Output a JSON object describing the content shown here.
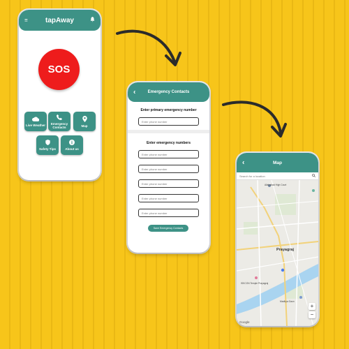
{
  "home": {
    "title": "tapAway",
    "menu_icon": "≡",
    "bell_icon": "🔔",
    "sos_label": "SOS",
    "tiles": [
      {
        "label": "Live Weather",
        "icon": "cloud-icon"
      },
      {
        "label": "Emergency Contacts",
        "icon": "phone-icon"
      },
      {
        "label": "Map",
        "icon": "map-pin-icon"
      },
      {
        "label": "Safety Tips",
        "icon": "shield-icon"
      },
      {
        "label": "About us",
        "icon": "info-icon"
      }
    ]
  },
  "contacts": {
    "title": "Emergency Contacts",
    "back_icon": "‹",
    "primary_heading": "Enter primary emergency number",
    "primary_placeholder": "Enter phone number",
    "secondary_heading": "Enter emergency numbers",
    "placeholders": [
      "Enter phone number",
      "Enter phone number",
      "Enter phone number",
      "Enter phone number",
      "Enter phone number"
    ],
    "save_label": "Save Emergency Contacts"
  },
  "map": {
    "title": "Map",
    "back_icon": "‹",
    "search_placeholder": "Search for a location",
    "city_label": "Prayagraj",
    "place_labels": [
      "Allahabad High Court",
      "Prayagraj",
      "ISKCON Temple Prayagraj",
      "Madhya Gaon"
    ],
    "zoom_in": "+",
    "zoom_out": "−",
    "attribution": "Google"
  },
  "colors": {
    "background": "#f7c51a",
    "teal": "#3d9286",
    "sos_red": "#ee1c1c"
  }
}
